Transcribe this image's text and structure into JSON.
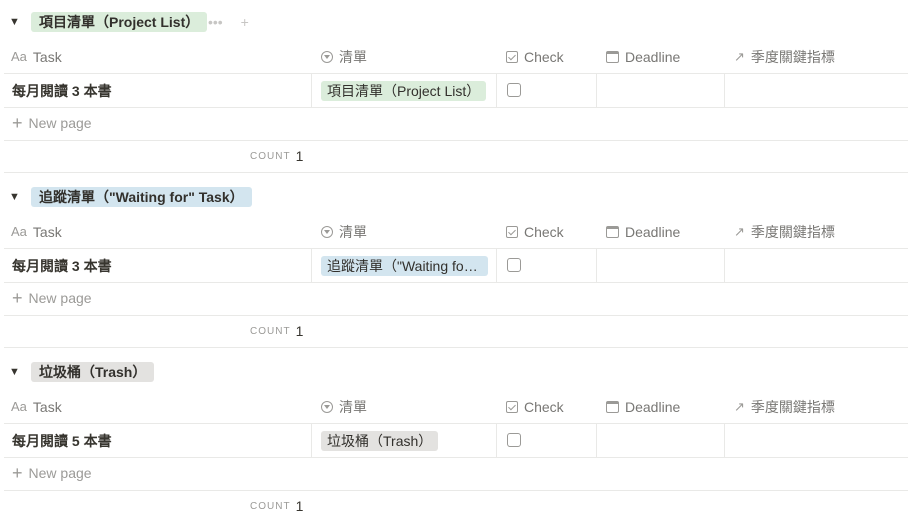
{
  "colors": {
    "project_tag_bg": "#dbeddb",
    "waiting_tag_bg": "#d3e5ef",
    "trash_tag_bg": "#e3e2e0"
  },
  "columns": {
    "task": {
      "label": "Task",
      "icon": "Aa"
    },
    "list": {
      "label": "清單",
      "icon": "select-icon"
    },
    "check": {
      "label": "Check",
      "icon": "checkbox-icon"
    },
    "deadline": {
      "label": "Deadline",
      "icon": "calendar-icon"
    },
    "kpi": {
      "label": "季度關鍵指標",
      "icon": "arrow-up-right-icon"
    }
  },
  "new_page_label": "New page",
  "count_label": "COUNT",
  "group_actions": {
    "more": "•••",
    "add": "+"
  },
  "groups": [
    {
      "tag": "項目清單（Project List）",
      "rows": [
        {
          "task": "每月閱讀 3 本書",
          "list": "項目清單（Project List）",
          "checked": false
        }
      ],
      "count": "1"
    },
    {
      "tag": "追蹤清單（\"Waiting for\" Task）",
      "rows": [
        {
          "task": "每月閱讀 3 本書",
          "list": "追蹤清單（\"Waiting for\" Task）",
          "checked": false
        }
      ],
      "count": "1"
    },
    {
      "tag": "垃圾桶（Trash）",
      "rows": [
        {
          "task": "每月閱讀 5 本書",
          "list": "垃圾桶（Trash）",
          "checked": false
        }
      ],
      "count": "1"
    }
  ]
}
